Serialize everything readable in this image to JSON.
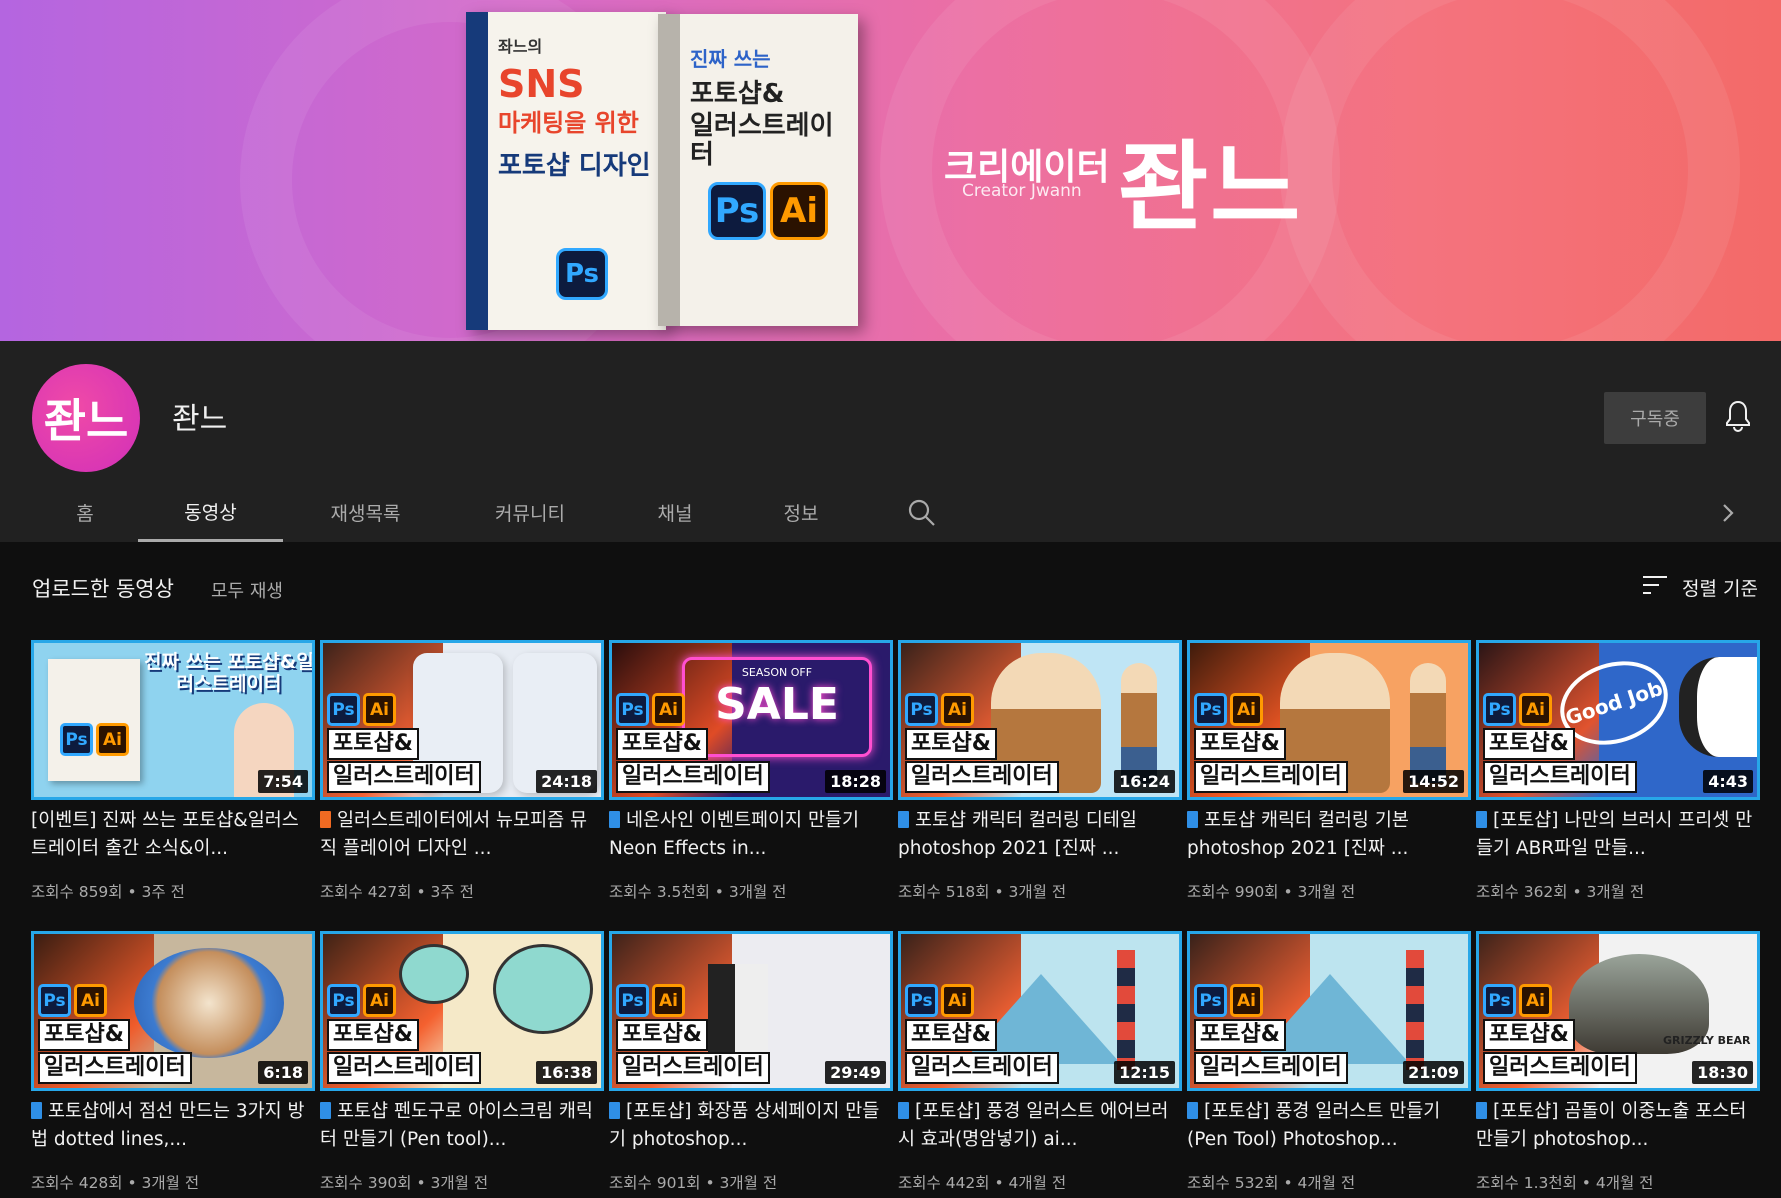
{
  "banner": {
    "book1_title": [
      "좌느의",
      "SNS",
      "마케팅을 위한",
      "포토샵 디자인"
    ],
    "book2_title": [
      "진짜 쓰는",
      "포토샵&",
      "일러스트레이터"
    ],
    "creator_ko": "크리에이터",
    "creator_en": "Creator Jwann",
    "name": "좐느"
  },
  "channel": {
    "avatar_text": "좐느",
    "name": "좐느",
    "subscribed_label": "구독중"
  },
  "tabs": [
    "홈",
    "동영상",
    "재생목록",
    "커뮤니티",
    "채널",
    "정보"
  ],
  "section": {
    "title": "업로드한 동영상",
    "play_all": "모두 재생",
    "sort_label": "정렬 기준"
  },
  "thumb_labels": {
    "line1": "포토샵&",
    "line2": "일러스트레이터",
    "ps": "Ps",
    "ai": "Ai"
  },
  "colors": {
    "ps": "#31a8ff",
    "ai": "#ff9a00",
    "thumb_border": "#27a7e8"
  },
  "videos": [
    {
      "duration": "7:54",
      "title": "[이벤트] 진짜 쓰는 포토샵&일러스트레이터 출간 소식&이...",
      "meta": "조회수 859회 • 3주 전",
      "icon": "none",
      "art": "#8fd3ef"
    },
    {
      "duration": "24:18",
      "title": "일러스트레이터에서 뉴모피즘 뮤직 플레이어 디자인 ...",
      "meta": "조회수 427회 • 3주 전",
      "icon": "orange-book-icon",
      "art": "#e7ecf3"
    },
    {
      "duration": "18:28",
      "title": "네온사인 이벤트페이지 만들기 Neon Effects in...",
      "meta": "조회수 3.5천회 • 3개월 전",
      "icon": "blue-book-icon",
      "art": "#2a1a6b"
    },
    {
      "duration": "16:24",
      "title": "포토샵 캐릭터 컬러링 디테일 photoshop 2021 [진짜 ...",
      "meta": "조회수 518회 • 3개월 전",
      "icon": "blue-book-icon",
      "art": "#bfe5f5"
    },
    {
      "duration": "14:52",
      "title": "포토샵 캐릭터 컬러링 기본 photoshop 2021 [진짜 ...",
      "meta": "조회수 990회 • 3개월 전",
      "icon": "blue-book-icon",
      "art": "#f7a262"
    },
    {
      "duration": "4:43",
      "title": "[포토샵] 나만의 브러시 프리셋 만들기 ABR파일 만들...",
      "meta": "조회수 362회 • 3개월 전",
      "icon": "blue-book-icon",
      "art": "#2f67c9"
    },
    {
      "duration": "6:18",
      "title": "포토샵에서 점선 만드는 3가지 방법 dotted lines,...",
      "meta": "조회수 428회 • 3개월 전",
      "icon": "blue-book-icon",
      "art": "#c7b79d"
    },
    {
      "duration": "16:38",
      "title": "포토샵 펜도구로 아이스크림 캐릭터 만들기 (Pen tool)...",
      "meta": "조회수 390회 • 3개월 전",
      "icon": "blue-book-icon",
      "art": "#f5e9c8"
    },
    {
      "duration": "29:49",
      "title": "[포토샵] 화장품 상세페이지 만들기 photoshop...",
      "meta": "조회수 901회 • 3개월 전",
      "icon": "blue-book-icon",
      "art": "#ececf1"
    },
    {
      "duration": "12:15",
      "title": "[포토샵] 풍경 일러스트 에어브러시 효과(명암넣기) ai...",
      "meta": "조회수 442회 • 4개월 전",
      "icon": "blue-book-icon",
      "art": "#bde4ef"
    },
    {
      "duration": "21:09",
      "title": "[포토샵] 풍경 일러스트 만들기 (Pen Tool) Photoshop...",
      "meta": "조회수 532회 • 4개월 전",
      "icon": "blue-book-icon",
      "art": "#bde4ef"
    },
    {
      "duration": "18:30",
      "title": "[포토샵] 곰돌이 이중노출 포스터 만들기 photoshop...",
      "meta": "조회수 1.3천회 • 4개월 전",
      "icon": "blue-book-icon",
      "art": "#f2f2f2"
    }
  ],
  "thumb_text": {
    "sale_top": "SEASON OFF",
    "sale": "SALE",
    "goodjob": "Good Job",
    "grizzly": "GRIZZLY BEAR",
    "book_cover": "진짜 쓰는 포토샵&일러스트레이터"
  }
}
